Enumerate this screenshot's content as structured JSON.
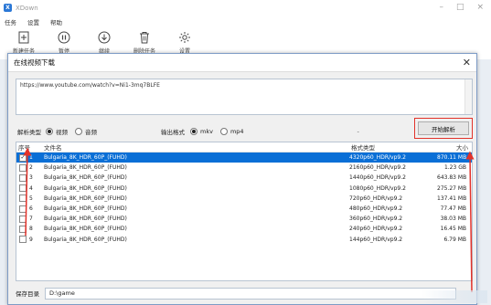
{
  "app": {
    "title": "XDown",
    "logo_letter": "X",
    "menu": [
      "任务",
      "设置",
      "帮助"
    ],
    "toolbar": [
      {
        "label": "新建任务",
        "icon": "plus-icon"
      },
      {
        "label": "暂停",
        "icon": "pause-icon"
      },
      {
        "label": "继续",
        "icon": "download-icon"
      },
      {
        "label": "删除任务",
        "icon": "trash-icon"
      },
      {
        "label": "设置",
        "icon": "gear-icon"
      }
    ]
  },
  "dialog": {
    "title": "在线视频下载",
    "url": "https://www.youtube.com/watch?v=Ni1-3mq7BLFE",
    "parse_type_label": "解析类型",
    "parse_types": [
      {
        "label": "视频",
        "selected": true
      },
      {
        "label": "音频",
        "selected": false
      }
    ],
    "output_format_label": "输出格式",
    "output_formats": [
      {
        "label": "mkv",
        "selected": true
      },
      {
        "label": "mp4",
        "selected": false
      }
    ],
    "dash": "-",
    "parse_button": "开始解析",
    "table": {
      "headers": [
        "序号",
        "文件名",
        "格式类型",
        "大小"
      ],
      "rows": [
        {
          "num": "1",
          "name": "Bulgaria_8K_HDR_60P_(FUHD)",
          "format": "4320p60_HDR/vp9.2",
          "size": "870.11 MB",
          "checked": true,
          "selected": true
        },
        {
          "num": "2",
          "name": "Bulgaria_8K_HDR_60P_(FUHD)",
          "format": "2160p60_HDR/vp9.2",
          "size": "1.23 GB",
          "checked": false,
          "selected": false
        },
        {
          "num": "3",
          "name": "Bulgaria_8K_HDR_60P_(FUHD)",
          "format": "1440p60_HDR/vp9.2",
          "size": "643.83 MB",
          "checked": false,
          "selected": false
        },
        {
          "num": "4",
          "name": "Bulgaria_8K_HDR_60P_(FUHD)",
          "format": "1080p60_HDR/vp9.2",
          "size": "275.27 MB",
          "checked": false,
          "selected": false
        },
        {
          "num": "5",
          "name": "Bulgaria_8K_HDR_60P_(FUHD)",
          "format": "720p60_HDR/vp9.2",
          "size": "137.41 MB",
          "checked": false,
          "selected": false
        },
        {
          "num": "6",
          "name": "Bulgaria_8K_HDR_60P_(FUHD)",
          "format": "480p60_HDR/vp9.2",
          "size": "77.47 MB",
          "checked": false,
          "selected": false
        },
        {
          "num": "7",
          "name": "Bulgaria_8K_HDR_60P_(FUHD)",
          "format": "360p60_HDR/vp9.2",
          "size": "38.03 MB",
          "checked": false,
          "selected": false
        },
        {
          "num": "8",
          "name": "Bulgaria_8K_HDR_60P_(FUHD)",
          "format": "240p60_HDR/vp9.2",
          "size": "16.45 MB",
          "checked": false,
          "selected": false
        },
        {
          "num": "9",
          "name": "Bulgaria_8K_HDR_60P_(FUHD)",
          "format": "144p60_HDR/vp9.2",
          "size": "6.79 MB",
          "checked": false,
          "selected": false
        }
      ]
    },
    "save_dir_label": "保存目录",
    "save_dir_value": "D:\\game"
  },
  "colors": {
    "selection": "#0a6fd6",
    "annotation_red": "#e2322a",
    "dialog_border": "#7e9cc6"
  }
}
